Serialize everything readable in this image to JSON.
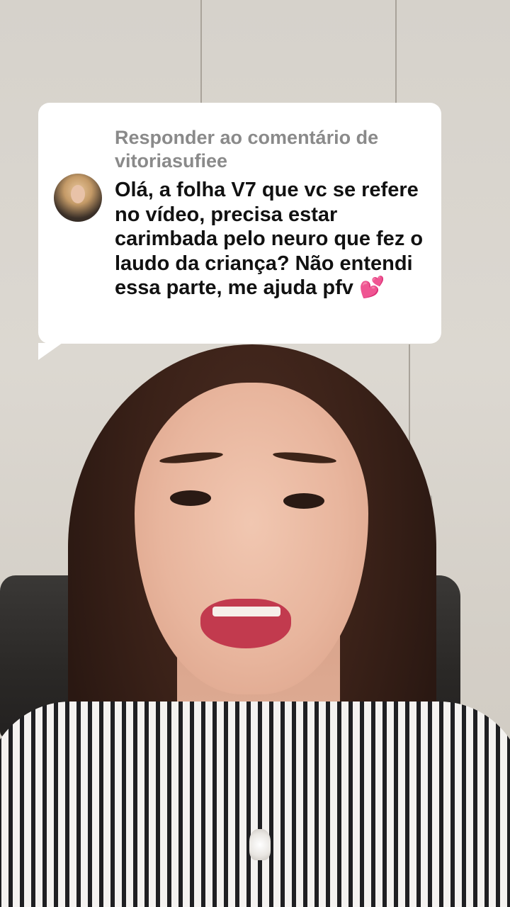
{
  "reply": {
    "label": "Responder ao comentário de vitoriasufiee",
    "comment": "Olá, a folha V7 que vc se refere no vídeo, precisa estar carimbada pelo neuro que fez o laudo da criança? Não entendi essa parte, me ajuda pfv",
    "emoji": "💕",
    "emoji_icon": "two-hearts-icon"
  },
  "colors": {
    "bubble": "#ffffff",
    "label_gray": "#8a8a8a",
    "text": "#111111"
  }
}
